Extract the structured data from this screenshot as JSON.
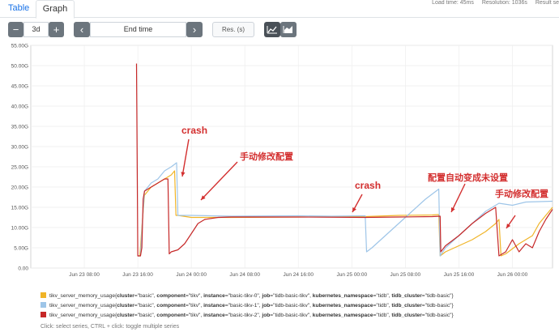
{
  "tabs": {
    "table": "Table",
    "graph": "Graph"
  },
  "stats": {
    "load": "Load time: 45ms",
    "resolution": "Resolution: 1036s",
    "result": "Result se"
  },
  "controls": {
    "minus": "−",
    "range": "3d",
    "plus": "+",
    "prev": "‹",
    "end_time": "End time",
    "next": "›",
    "res_placeholder": "Res. (s)",
    "line_icon": "line-chart-icon",
    "stacked_icon": "stacked-chart-icon"
  },
  "chart_data": {
    "type": "line",
    "ylim": [
      0,
      55
    ],
    "y_ticks": [
      "0.00",
      "5.00G",
      "10.00G",
      "15.00G",
      "20.00G",
      "25.00G",
      "30.00G",
      "35.00G",
      "40.00G",
      "45.00G",
      "50.00G",
      "55.00G"
    ],
    "x_ticks": [
      "Jun 23 08:00",
      "Jun 23 16:00",
      "Jun 24 00:00",
      "Jun 24 08:00",
      "Jun 24 16:00",
      "Jun 25 00:00",
      "Jun 25 08:00",
      "Jun 25 16:00",
      "Jun 26 00:00"
    ],
    "x_range_hours": [
      0,
      78
    ],
    "series": [
      {
        "name": "tikv_server_memory_usage{cluster=\"basic\", component=\"tikv\", instance=\"basic-tikv-0\", job=\"tidb-basic-tikv\", kubernetes_namespace=\"tidb\", tidb_cluster=\"tidb-basic\"}",
        "color": "#f0b428",
        "points": [
          [
            16.0,
            3
          ],
          [
            16.3,
            3
          ],
          [
            16.6,
            10
          ],
          [
            17.0,
            18
          ],
          [
            17.5,
            19
          ],
          [
            18,
            20
          ],
          [
            19,
            21
          ],
          [
            20,
            22
          ],
          [
            21,
            23
          ],
          [
            21.5,
            24
          ],
          [
            21.7,
            13
          ],
          [
            22,
            13
          ],
          [
            24,
            12.5
          ],
          [
            30,
            12.5
          ],
          [
            40,
            12.6
          ],
          [
            50,
            12.7
          ],
          [
            55,
            13
          ],
          [
            60,
            13.1
          ],
          [
            61,
            13.2
          ],
          [
            61.2,
            3
          ],
          [
            62,
            4
          ],
          [
            64,
            5.5
          ],
          [
            66,
            7
          ],
          [
            68,
            9
          ],
          [
            69.5,
            11
          ],
          [
            70,
            12
          ],
          [
            70.3,
            3
          ],
          [
            71,
            3.5
          ],
          [
            73,
            6
          ],
          [
            75,
            8
          ],
          [
            76,
            11
          ],
          [
            77,
            13
          ],
          [
            78,
            15
          ]
        ]
      },
      {
        "name": "tikv_server_memory_usage{cluster=\"basic\", component=\"tikv\", instance=\"basic-tikv-1\", job=\"tidb-basic-tikv\", kubernetes_namespace=\"tidb\", tidb_cluster=\"tidb-basic\"}",
        "color": "#9ec5e8",
        "points": [
          [
            16.0,
            3
          ],
          [
            16.4,
            3
          ],
          [
            16.7,
            12
          ],
          [
            17.0,
            19
          ],
          [
            18,
            21
          ],
          [
            19,
            22
          ],
          [
            20,
            24
          ],
          [
            21,
            25
          ],
          [
            21.8,
            26
          ],
          [
            22,
            13
          ],
          [
            24,
            13
          ],
          [
            30,
            12.8
          ],
          [
            40,
            12.9
          ],
          [
            45,
            12.8
          ],
          [
            50,
            12.9
          ],
          [
            50.2,
            4
          ],
          [
            51,
            5
          ],
          [
            53,
            8
          ],
          [
            55,
            11
          ],
          [
            57,
            14
          ],
          [
            59,
            17
          ],
          [
            61,
            19.5
          ],
          [
            61.2,
            3
          ],
          [
            62,
            5
          ],
          [
            64,
            8
          ],
          [
            66,
            11
          ],
          [
            68,
            14
          ],
          [
            70,
            16
          ],
          [
            72,
            15.5
          ],
          [
            74,
            16.3
          ],
          [
            78,
            16.5
          ]
        ]
      },
      {
        "name": "tikv_server_memory_usage{cluster=\"basic\", component=\"tikv\", instance=\"basic-tikv-2\", job=\"tidb-basic-tikv\", kubernetes_namespace=\"tidb\", tidb_cluster=\"tidb-basic\"}",
        "color": "#c62828",
        "points": [
          [
            15.8,
            50.5
          ],
          [
            16.0,
            3
          ],
          [
            16.4,
            3
          ],
          [
            16.6,
            5
          ],
          [
            16.8,
            17
          ],
          [
            17.0,
            19
          ],
          [
            18,
            20
          ],
          [
            19,
            21
          ],
          [
            20,
            22
          ],
          [
            20.5,
            22
          ],
          [
            20.7,
            3.5
          ],
          [
            21,
            4
          ],
          [
            22,
            4.5
          ],
          [
            23,
            6
          ],
          [
            24,
            8.5
          ],
          [
            25,
            11
          ],
          [
            26,
            12
          ],
          [
            28,
            12.5
          ],
          [
            30,
            12.6
          ],
          [
            40,
            12.6
          ],
          [
            50,
            12.5
          ],
          [
            55,
            12.6
          ],
          [
            60,
            12.7
          ],
          [
            61.2,
            12.8
          ],
          [
            61.3,
            4
          ],
          [
            62,
            5.5
          ],
          [
            64,
            8
          ],
          [
            66,
            11
          ],
          [
            68,
            13.5
          ],
          [
            69.5,
            15
          ],
          [
            70,
            3
          ],
          [
            71,
            4
          ],
          [
            72,
            7
          ],
          [
            73,
            4
          ],
          [
            74,
            6
          ],
          [
            75,
            5
          ],
          [
            76,
            9
          ],
          [
            77,
            12
          ],
          [
            78,
            14.5
          ]
        ]
      }
    ],
    "annotations": [
      {
        "text": "crash",
        "color": "#d32f2f"
      },
      {
        "text": "手动修改配置",
        "color": "#d32f2f"
      },
      {
        "text": "crash",
        "color": "#d32f2f"
      },
      {
        "text": "配置自动变成未设置",
        "color": "#d32f2f"
      },
      {
        "text": "手动修改配置",
        "color": "#d32f2f"
      }
    ]
  },
  "legend": [
    {
      "prefix": "tikv_server_memory_usage{",
      "k1": "cluster",
      "v1": "=\"basic\", ",
      "k2": "component",
      "v2": "=\"tikv\", ",
      "k3": "instance",
      "v3": "=\"basic-tikv-0\", ",
      "k4": "job",
      "v4": "=\"tidb-basic-tikv\", ",
      "k5": "kubernetes_namespace",
      "v5": "=\"tidb\", ",
      "k6": "tidb_cluster",
      "v6": "=\"tidb-basic\"}",
      "color": "#f0b428"
    },
    {
      "prefix": "tikv_server_memory_usage{",
      "k1": "cluster",
      "v1": "=\"basic\", ",
      "k2": "component",
      "v2": "=\"tikv\", ",
      "k3": "instance",
      "v3": "=\"basic-tikv-1\", ",
      "k4": "job",
      "v4": "=\"tidb-basic-tikv\", ",
      "k5": "kubernetes_namespace",
      "v5": "=\"tidb\", ",
      "k6": "tidb_cluster",
      "v6": "=\"tidb-basic\"}",
      "color": "#9ec5e8"
    },
    {
      "prefix": "tikv_server_memory_usage{",
      "k1": "cluster",
      "v1": "=\"basic\", ",
      "k2": "component",
      "v2": "=\"tikv\", ",
      "k3": "instance",
      "v3": "=\"basic-tikv-2\", ",
      "k4": "job",
      "v4": "=\"tidb-basic-tikv\", ",
      "k5": "kubernetes_namespace",
      "v5": "=\"tidb\", ",
      "k6": "tidb_cluster",
      "v6": "=\"tidb-basic\"}",
      "color": "#c62828"
    }
  ],
  "hint": "Click: select series, CTRL + click: toggle multiple series"
}
